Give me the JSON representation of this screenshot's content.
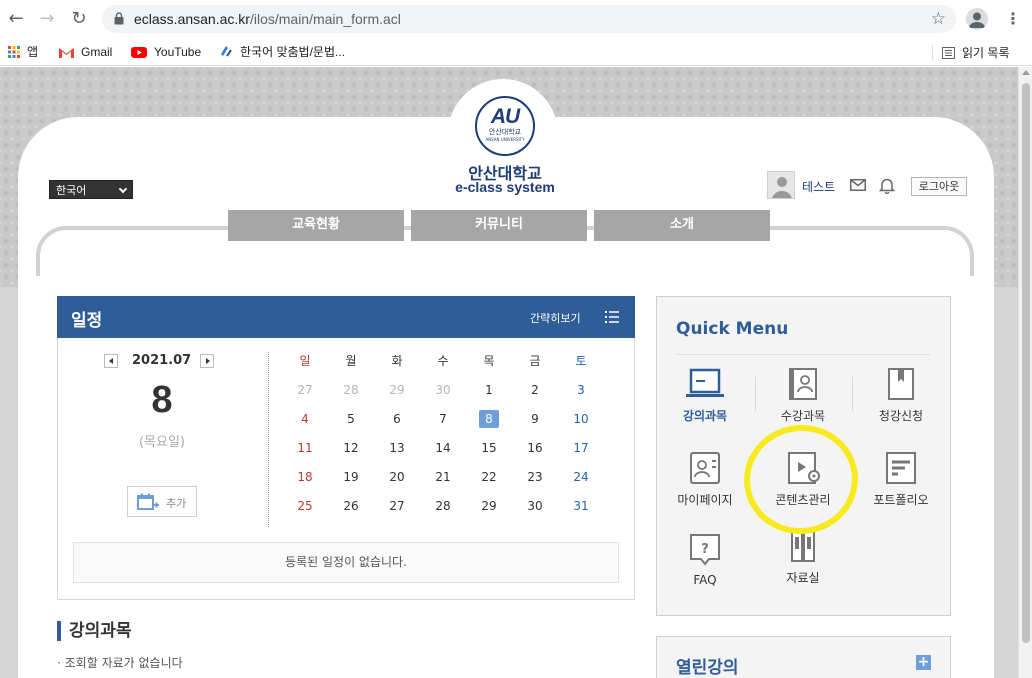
{
  "browser": {
    "url_host": "eclass.ansan.ac.kr",
    "url_path": "/ilos/main/main_form.acl",
    "bookmarks": [
      {
        "label": "앱",
        "icon": "apps-icon"
      },
      {
        "label": "Gmail",
        "icon": "gmail-icon"
      },
      {
        "label": "YouTube",
        "icon": "youtube-icon"
      },
      {
        "label": "한국어 맞춤법/문법...",
        "icon": "spellcheck-icon"
      }
    ],
    "reading_list": "읽기 목록"
  },
  "header": {
    "logo_text": "AU",
    "logo_sub": "안산대학교",
    "logo_sub_en": "ANSAN UNIVERSITY",
    "site_name": "안산대학교",
    "site_sub": "e-class system",
    "language": "한국어",
    "user_name": "테스트",
    "logout_label": "로그아웃"
  },
  "main_menu": [
    "교육현황",
    "커뮤니티",
    "소개"
  ],
  "schedule": {
    "title": "일정",
    "simple_view": "간략히보기",
    "month": "2021.07",
    "day": "8",
    "weekday": "(목요일)",
    "add_label": "추가",
    "weekday_headers": [
      "일",
      "월",
      "화",
      "수",
      "목",
      "금",
      "토"
    ],
    "weeks": [
      [
        "27",
        "28",
        "29",
        "30",
        "1",
        "2",
        "3"
      ],
      [
        "4",
        "5",
        "6",
        "7",
        "8",
        "9",
        "10"
      ],
      [
        "11",
        "12",
        "13",
        "14",
        "15",
        "16",
        "17"
      ],
      [
        "18",
        "19",
        "20",
        "21",
        "22",
        "23",
        "24"
      ],
      [
        "25",
        "26",
        "27",
        "28",
        "29",
        "30",
        "31"
      ]
    ],
    "today": "8",
    "empty_message": "등록된 일정이 없습니다."
  },
  "courses": {
    "title": "강의과목",
    "empty_message": "· 조회할 자료가 없습니다"
  },
  "quick_menu": {
    "title": "Quick Menu",
    "items": [
      {
        "label": "강의과목",
        "icon": "laptop-icon"
      },
      {
        "label": "수강과목",
        "icon": "book-user-icon"
      },
      {
        "label": "청강신청",
        "icon": "bookmark-book-icon"
      },
      {
        "label": "마이페이지",
        "icon": "profile-card-icon"
      },
      {
        "label": "콘텐츠관리",
        "icon": "video-settings-icon"
      },
      {
        "label": "포트폴리오",
        "icon": "portfolio-icon"
      },
      {
        "label": "FAQ",
        "icon": "faq-icon"
      },
      {
        "label": "자료실",
        "icon": "binders-icon"
      }
    ]
  },
  "open_lectures": {
    "title": "열린강의",
    "more": "+"
  },
  "colors": {
    "primary": "#2f5d97",
    "logo": "#1e3c78",
    "highlight": "#f7ea1f",
    "today": "#6f9fd8"
  }
}
